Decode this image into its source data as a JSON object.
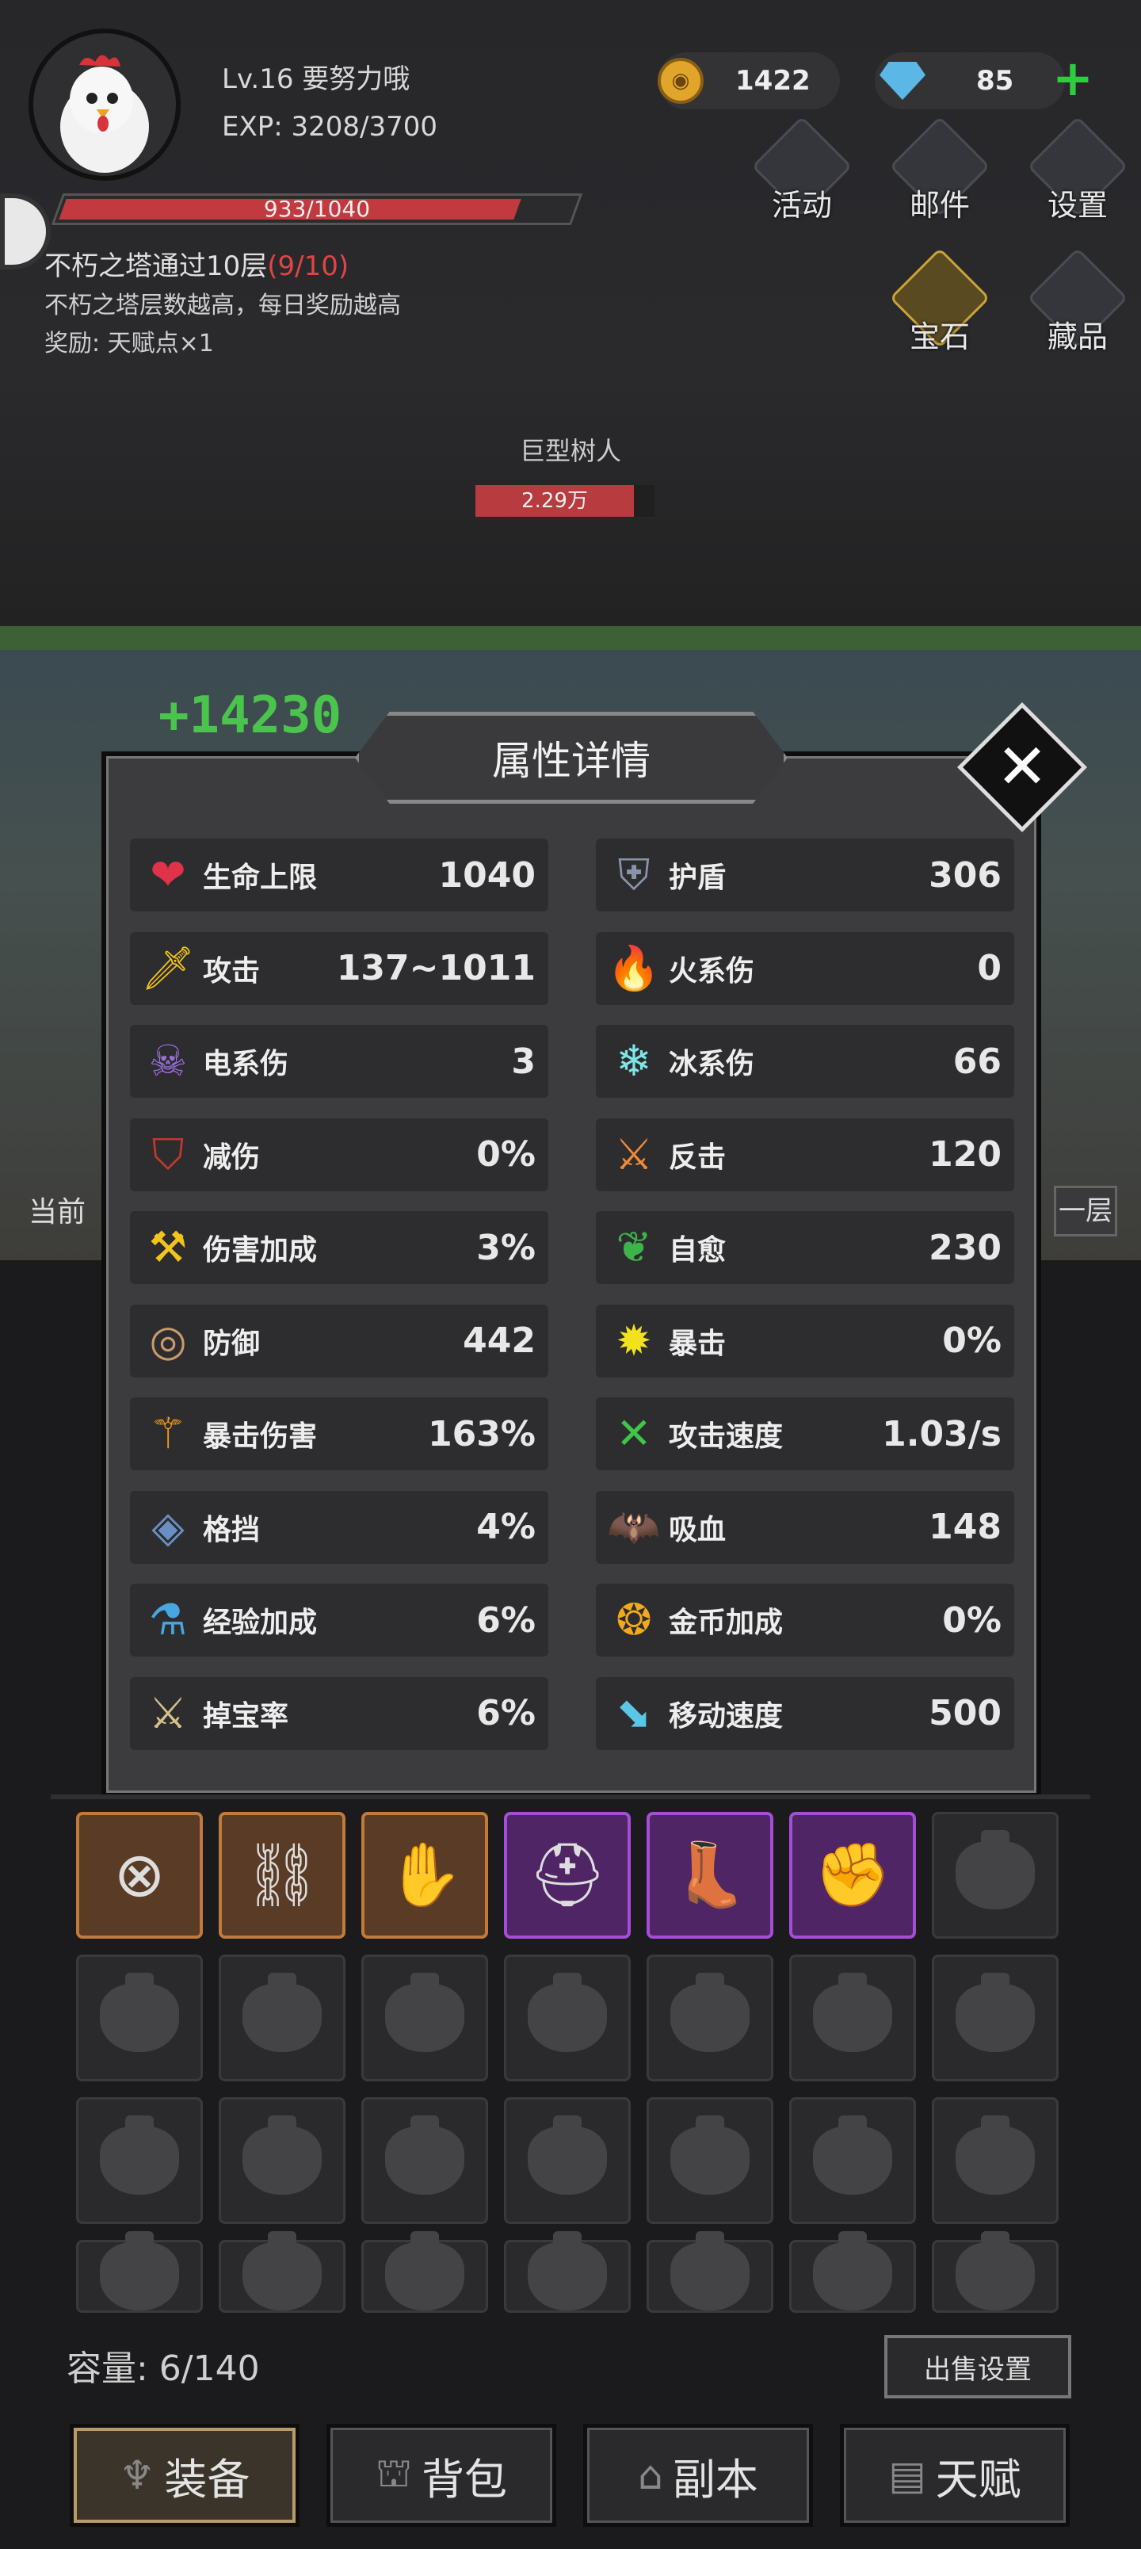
{
  "player": {
    "level_label": "Lv.16 要努力哦",
    "exp_label": "EXP: 3208/3700",
    "hp_label": "933/1040",
    "hp_fraction": 0.897
  },
  "currency": {
    "gold": "1422",
    "gems": "85"
  },
  "top_menu": {
    "activity": "活动",
    "mail": "邮件",
    "settings": "设置",
    "gem": "宝石",
    "collection": "藏品"
  },
  "quest": {
    "title": "不朽之塔通过10层",
    "progress": "(9/10)",
    "desc": "不朽之塔层数越高，每日奖励越高",
    "reward": "奖励: 天赋点×1"
  },
  "boss": {
    "name": "巨型树人",
    "hp": "2.29万"
  },
  "battle": {
    "damage_text": "+14230",
    "left_label": "当前",
    "right_label": "一层"
  },
  "modal": {
    "title": "属性详情",
    "stats": [
      {
        "name": "生命上限",
        "value": "1040",
        "icon": "heart-icon",
        "glyph": "❤",
        "color": "#e0334a"
      },
      {
        "name": "护盾",
        "value": "306",
        "icon": "shield-icon",
        "glyph": "⛨",
        "color": "#8a94a8"
      },
      {
        "name": "攻击",
        "value": "137~1011",
        "icon": "sword-icon",
        "glyph": "🗡",
        "color": "#f2c51c"
      },
      {
        "name": "火系伤",
        "value": "0",
        "icon": "fire-icon",
        "glyph": "🔥",
        "color": "#ff5a1f"
      },
      {
        "name": "电系伤",
        "value": "3",
        "icon": "lightning-skull-icon",
        "glyph": "☠",
        "color": "#9b6fe0"
      },
      {
        "name": "冰系伤",
        "value": "66",
        "icon": "snowflake-icon",
        "glyph": "❄",
        "color": "#7fe6e6"
      },
      {
        "name": "减伤",
        "value": "0%",
        "icon": "damage-reduction-shield-icon",
        "glyph": "⛉",
        "color": "#c0392b"
      },
      {
        "name": "反击",
        "value": "120",
        "icon": "crossed-swords-icon",
        "glyph": "⚔",
        "color": "#f08a3a"
      },
      {
        "name": "伤害加成",
        "value": "3%",
        "icon": "axe-icon",
        "glyph": "⚒",
        "color": "#f2c51c"
      },
      {
        "name": "自愈",
        "value": "230",
        "icon": "leaf-icon",
        "glyph": "❦",
        "color": "#3db34a"
      },
      {
        "name": "防御",
        "value": "442",
        "icon": "round-shield-icon",
        "glyph": "◎",
        "color": "#c79a6b"
      },
      {
        "name": "暴击",
        "value": "0%",
        "icon": "crit-burst-icon",
        "glyph": "✹",
        "color": "#f2e21c"
      },
      {
        "name": "暴击伤害",
        "value": "163%",
        "icon": "triple-blade-icon",
        "glyph": "⚚",
        "color": "#f29a1c"
      },
      {
        "name": "攻击速度",
        "value": "1.03/s",
        "icon": "crossed-arrows-icon",
        "glyph": "✕",
        "color": "#3ec64a"
      },
      {
        "name": "格挡",
        "value": "4%",
        "icon": "block-shield-icon",
        "glyph": "◈",
        "color": "#6a8fc4"
      },
      {
        "name": "吸血",
        "value": "148",
        "icon": "bat-icon",
        "glyph": "🦇",
        "color": "#d8323a"
      },
      {
        "name": "经验加成",
        "value": "6%",
        "icon": "exp-potion-icon",
        "glyph": "⚗",
        "color": "#4aa6e0"
      },
      {
        "name": "金币加成",
        "value": "0%",
        "icon": "gold-bonus-icon",
        "glyph": "❂",
        "color": "#f2a91c"
      },
      {
        "name": "掉宝率",
        "value": "6%",
        "icon": "loot-rate-icon",
        "glyph": "⚔",
        "color": "#d8c08a"
      },
      {
        "name": "移动速度",
        "value": "500",
        "icon": "boot-icon",
        "glyph": "⬊",
        "color": "#5bc6e6"
      }
    ]
  },
  "inventory": {
    "equipped": [
      {
        "name": "round-shield-item",
        "rarity": "orange",
        "glyph": "⊗"
      },
      {
        "name": "leg-armor-item",
        "rarity": "orange",
        "glyph": "⛓"
      },
      {
        "name": "gauntlet-item",
        "rarity": "orange",
        "glyph": "✋"
      },
      {
        "name": "helmet-item",
        "rarity": "purple",
        "glyph": "⛑"
      },
      {
        "name": "boots-item",
        "rarity": "purple",
        "glyph": "👢"
      },
      {
        "name": "glove-item",
        "rarity": "purple",
        "glyph": "✊"
      }
    ],
    "capacity_label": "容量: 6/140",
    "sell_settings": "出售设置"
  },
  "nav": {
    "equipment": "装备",
    "backpack": "背包",
    "dungeon": "副本",
    "talent": "天赋"
  }
}
